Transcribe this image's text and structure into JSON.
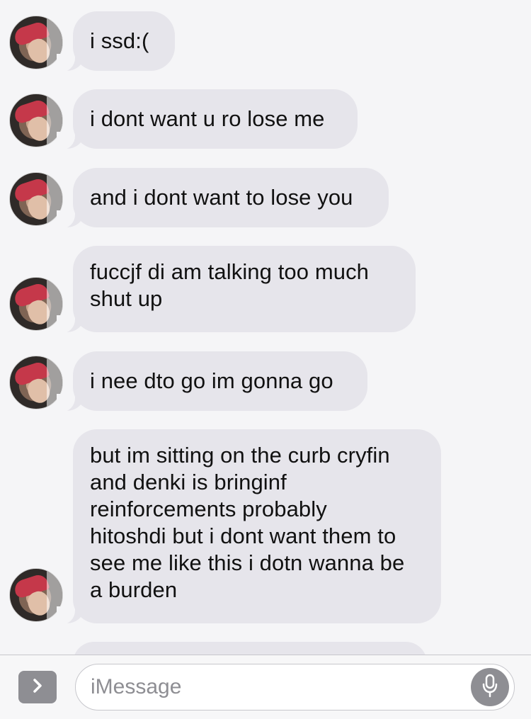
{
  "messages": [
    {
      "text": "i ssd:("
    },
    {
      "text": "i dont want u ro lose me"
    },
    {
      "text": "and i dont want to lose you"
    },
    {
      "lines": [
        "fuccjf di am talking too much",
        "shut up"
      ]
    },
    {
      "text": "i nee dto go im gonna go"
    },
    {
      "lines": [
        "but im sitting on the curb cryfin",
        "and denki is bringinf",
        "reinforcements probably",
        "hitoshdi but i dont want them to",
        "see me like this i dotn wanna be",
        "a burden"
      ]
    }
  ],
  "composer": {
    "placeholder": "iMessage",
    "expand_icon": "chevron-right-icon",
    "mic_icon": "microphone-icon"
  },
  "colors": {
    "received_bubble": "#e6e5eb",
    "background": "#f5f5f7",
    "placeholder_text": "#8e8e93",
    "icon_button": "#8e8e93"
  }
}
